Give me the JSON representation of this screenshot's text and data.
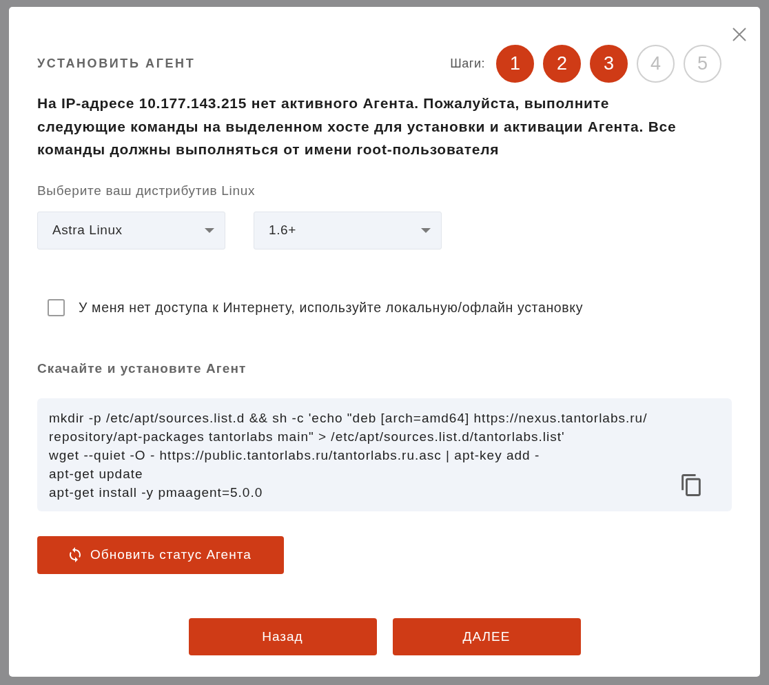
{
  "dialog": {
    "title": "УСТАНОВИТЬ АГЕНТ",
    "steps_label": "Шаги:",
    "steps": [
      {
        "label": "1",
        "completed": true
      },
      {
        "label": "2",
        "completed": true
      },
      {
        "label": "3",
        "completed": true
      },
      {
        "label": "4",
        "completed": false
      },
      {
        "label": "5",
        "completed": false
      }
    ]
  },
  "message": "На IP-адресе 10.177.143.215 нет активного Агента. Пожалуйста, выполните следующие команды на выделенном хосте для установки и активации Агента. Все команды должны выполняться от имени root-пользователя",
  "distro": {
    "label": "Выберите ваш дистрибутив Linux",
    "distribution": {
      "value": "Astra Linux"
    },
    "version": {
      "value": "1.6+"
    }
  },
  "offline": {
    "label": "У меня нет доступа к Интернету, используйте локальную/офлайн установку",
    "checked": false
  },
  "install": {
    "heading": "Скачайте и установите Агент",
    "code_lines": [
      "mkdir -p /etc/apt/sources.list.d && sh -c 'echo \"deb [arch=amd64] https://nexus.tantorlabs.ru/",
      "repository/apt-packages tantorlabs main\" > /etc/apt/sources.list.d/tantorlabs.list'",
      "wget --quiet -O - https://public.tantorlabs.ru/tantorlabs.ru.asc | apt-key add -",
      "apt-get update",
      "apt-get install -y pmaagent=5.0.0"
    ]
  },
  "refresh_button": "Обновить статус Агента",
  "buttons": [
    "Назад",
    "ДАЛЕЕ"
  ]
}
